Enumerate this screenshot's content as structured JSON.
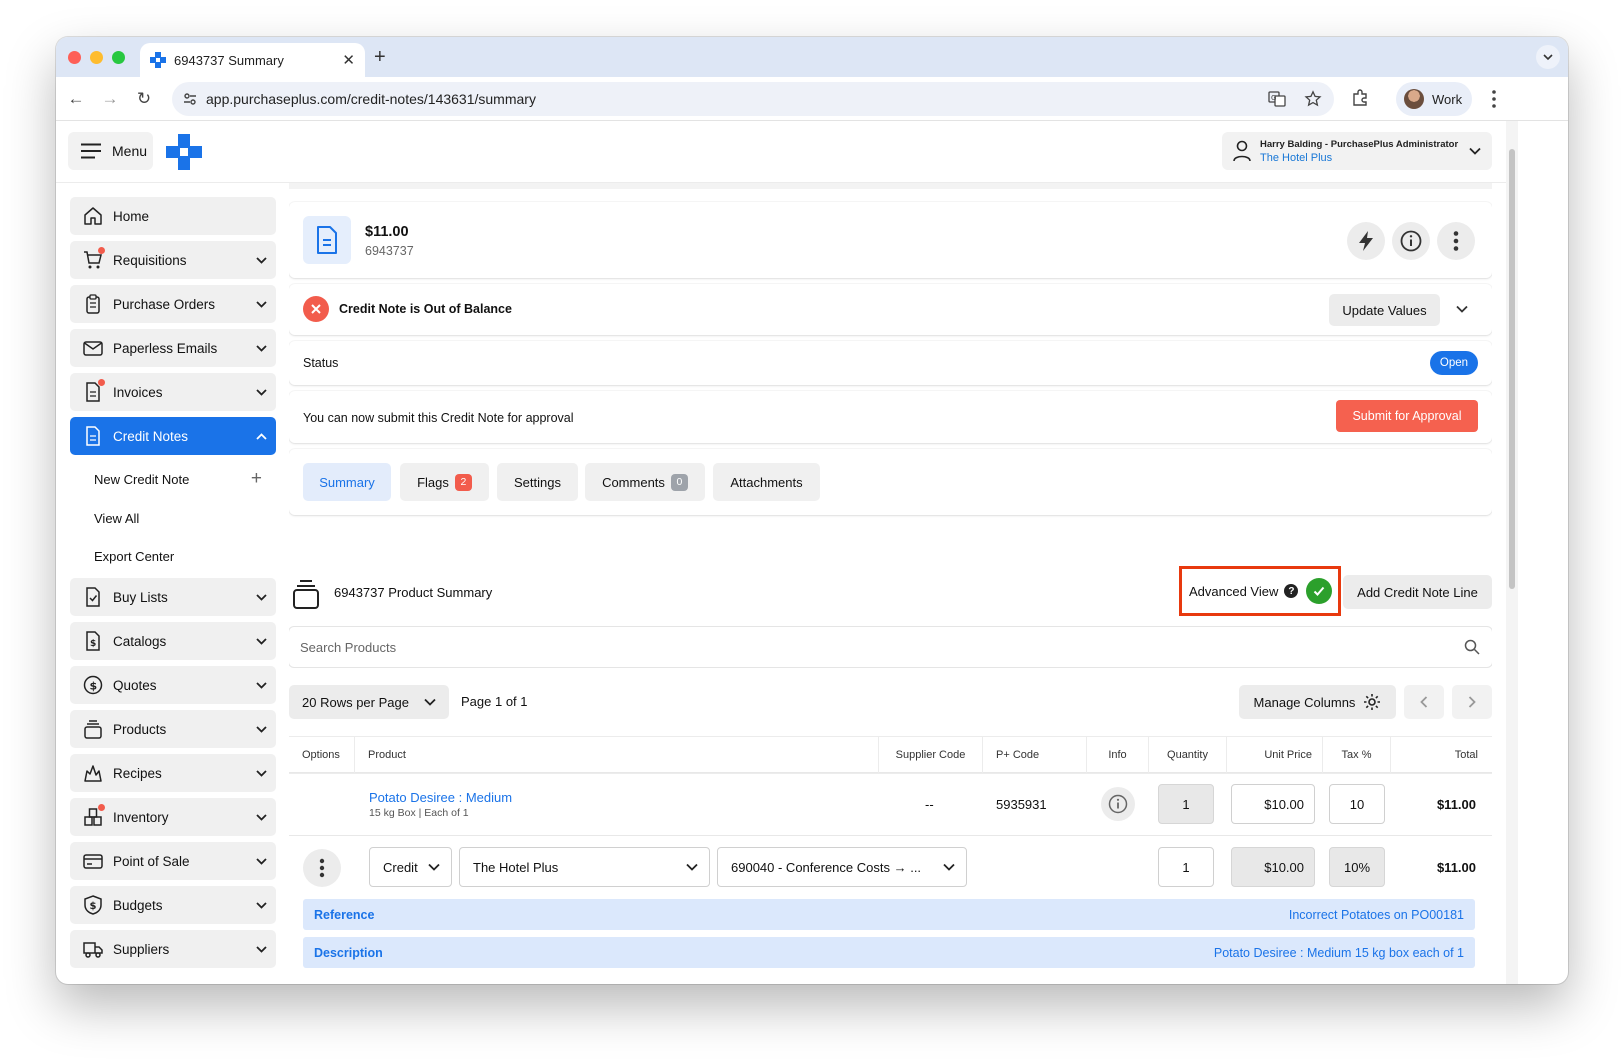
{
  "browser": {
    "tab_title": "6943737 Summary",
    "url": "app.purchaseplus.com/credit-notes/143631/summary",
    "profile_label": "Work"
  },
  "header": {
    "menu_label": "Menu",
    "user_name": "Harry Balding - PurchasePlus Administrator",
    "user_org": "The Hotel Plus"
  },
  "sidebar": {
    "items": [
      {
        "label": "Home",
        "icon": "home-icon"
      },
      {
        "label": "Requisitions",
        "icon": "cart-icon"
      },
      {
        "label": "Purchase Orders",
        "icon": "clipboard-icon"
      },
      {
        "label": "Paperless Emails",
        "icon": "mail-icon"
      },
      {
        "label": "Invoices",
        "icon": "invoice-icon"
      },
      {
        "label": "Credit Notes",
        "icon": "document-icon"
      },
      {
        "label": "Buy Lists",
        "icon": "checklist-icon"
      },
      {
        "label": "Catalogs",
        "icon": "dollar-doc-icon"
      },
      {
        "label": "Quotes",
        "icon": "dollar-circle-icon"
      },
      {
        "label": "Products",
        "icon": "stack-icon"
      },
      {
        "label": "Recipes",
        "icon": "flame-icon"
      },
      {
        "label": "Inventory",
        "icon": "boxes-icon"
      },
      {
        "label": "Point of Sale",
        "icon": "card-icon"
      },
      {
        "label": "Budgets",
        "icon": "shield-dollar-icon"
      },
      {
        "label": "Suppliers",
        "icon": "truck-icon"
      }
    ],
    "sub_items": [
      "New Credit Note",
      "View All",
      "Export Center"
    ]
  },
  "summary": {
    "amount": "$11.00",
    "doc_number": "6943737"
  },
  "balance": {
    "message": "Credit Note is Out of Balance",
    "update_label": "Update Values"
  },
  "status": {
    "label": "Status",
    "value": "Open"
  },
  "submit": {
    "message": "You can now submit this Credit Note for approval",
    "button": "Submit for Approval"
  },
  "tabs": [
    {
      "label": "Summary"
    },
    {
      "label": "Flags",
      "badge": "2"
    },
    {
      "label": "Settings"
    },
    {
      "label": "Comments",
      "badge": "0"
    },
    {
      "label": "Attachments"
    }
  ],
  "product_summary": {
    "title": "6943737 Product Summary",
    "advanced_view_label": "Advanced View",
    "advanced_view_enabled": true,
    "add_line_label": "Add Credit Note Line",
    "search_placeholder": "Search Products",
    "rows_per_page": "20 Rows per Page",
    "page_label": "Page 1 of 1",
    "manage_columns": "Manage Columns"
  },
  "table": {
    "columns": [
      "Options",
      "Product",
      "Supplier Code",
      "P+ Code",
      "Info",
      "Quantity",
      "Unit Price",
      "Tax %",
      "Total"
    ],
    "row": {
      "product_name": "Potato Desiree : Medium",
      "product_detail": "15 kg Box | Each of 1",
      "supplier_code": "--",
      "p_code": "5935931",
      "quantity": "1",
      "unit_price": "$10.00",
      "tax": "10",
      "total": "$11.00"
    },
    "line": {
      "type": "Credit",
      "department": "The Hotel Plus",
      "account": "690040 - Conference Costs → ...",
      "quantity": "1",
      "unit_price": "$10.00",
      "tax": "10%",
      "total": "$11.00",
      "reference_label": "Reference",
      "reference_value": "Incorrect Potatoes on PO00181",
      "description_label": "Description",
      "description_value": "Potato Desiree : Medium 15 kg box each of 1"
    }
  },
  "colors": {
    "accent": "#1a73e8",
    "danger": "#f5614f",
    "success": "#2ca02c",
    "highlight_border": "#e8390e"
  }
}
